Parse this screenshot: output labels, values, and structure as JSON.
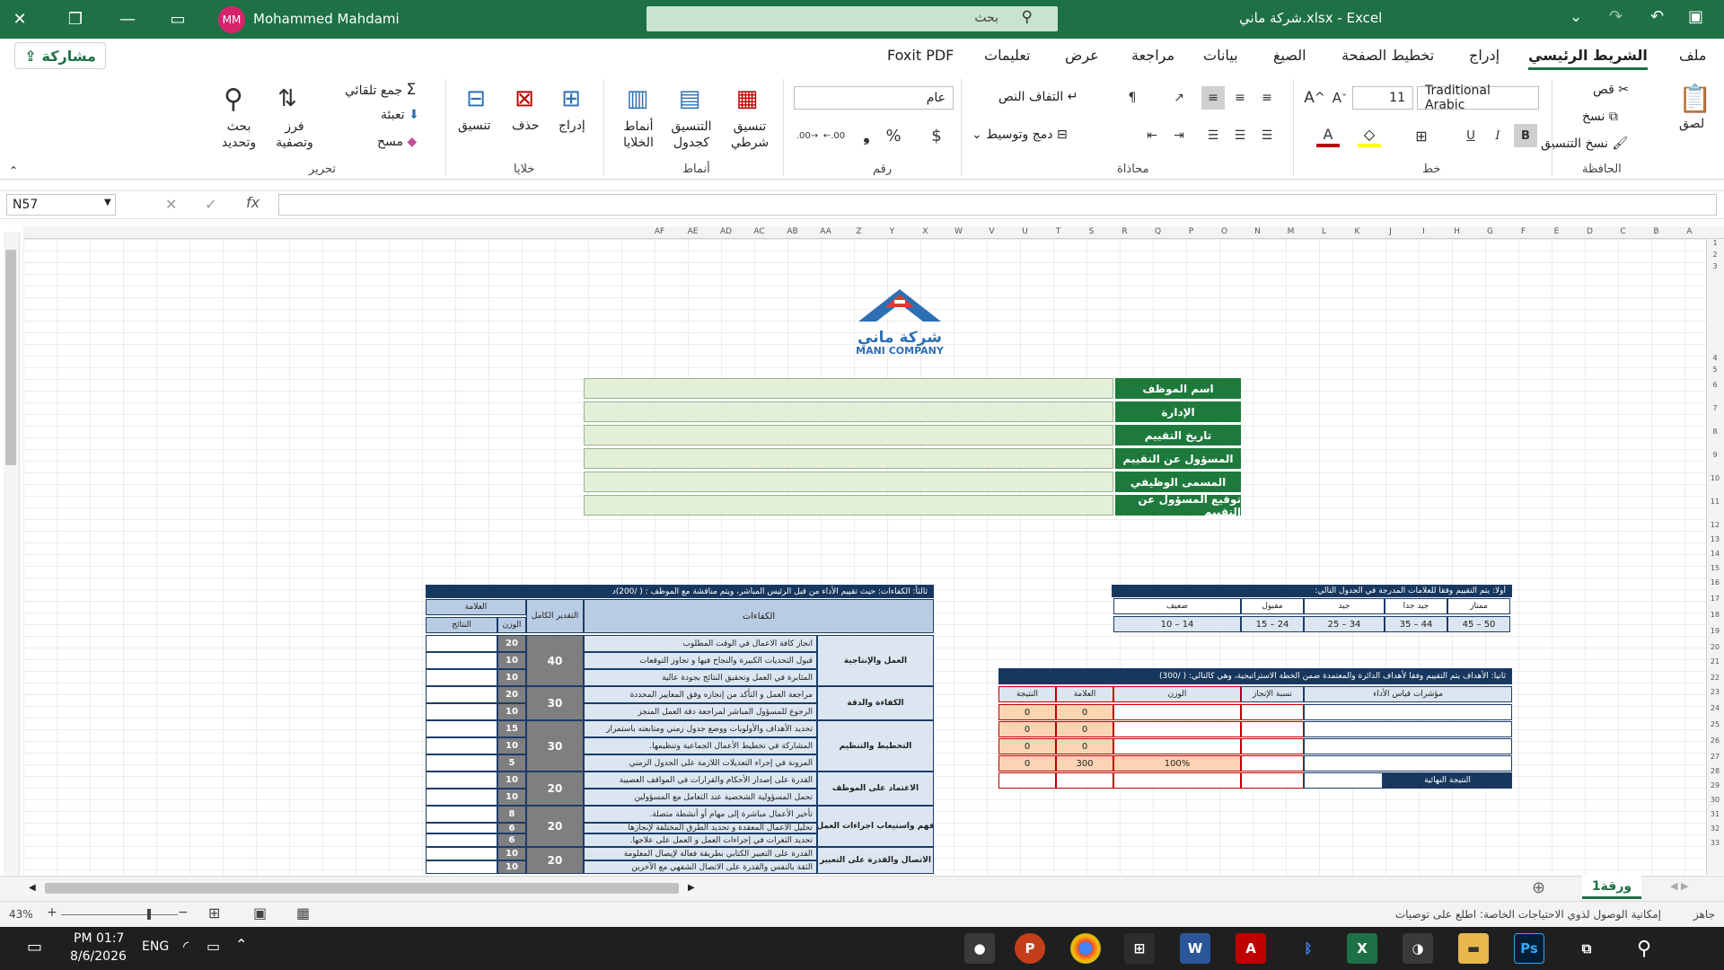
{
  "titlebar": {
    "file_title": "شركة ماني.xlsx  -  Excel",
    "user_name": "Mohammed Mahdami",
    "user_initials": "MM",
    "search_placeholder": "بحث"
  },
  "tabs": [
    "ملف",
    "الشريط الرئيسي",
    "إدراج",
    "تخطيط الصفحة",
    "الصيغ",
    "بيانات",
    "مراجعة",
    "عرض",
    "تعليمات",
    "Foxit PDF"
  ],
  "share_label": "مشاركة",
  "ribbon": {
    "clipboard": {
      "group": "الحافظة",
      "paste": "لصق",
      "cut": "قص",
      "copy": "نسخ",
      "format_painter": "نسخ التنسيق"
    },
    "font": {
      "group": "خط",
      "name": "Traditional Arabic",
      "size": "11"
    },
    "alignment": {
      "group": "محاذاة",
      "wrap": "التفاف النص",
      "merge": "دمج وتوسيط"
    },
    "number": {
      "group": "رقم",
      "format": "عام"
    },
    "styles": {
      "group": "أنماط",
      "conditional": "تنسيق شرطي",
      "as_table": "التنسيق كجدول",
      "cell_styles": "أنماط الخلايا"
    },
    "cells": {
      "group": "خلايا",
      "insert": "إدراج",
      "delete": "حذف",
      "format": "تنسيق"
    },
    "editing": {
      "group": "تحرير",
      "autosum": "جمع تلقائي",
      "fill": "تعبئة",
      "clear": "مسح",
      "sort": "فرز وتصفية",
      "find": "بحث وتحديد"
    }
  },
  "formula_bar": {
    "name_box": "N57",
    "formula": ""
  },
  "columns": [
    "A",
    "B",
    "C",
    "D",
    "E",
    "F",
    "G",
    "H",
    "I",
    "J",
    "K",
    "L",
    "M",
    "N",
    "O",
    "P",
    "Q",
    "R",
    "S",
    "T",
    "U",
    "V",
    "W",
    "X",
    "Y",
    "Z",
    "AA",
    "AB",
    "AC",
    "AD",
    "AE",
    "AF"
  ],
  "rows": [
    "1",
    "2",
    "3",
    "4",
    "5",
    "6",
    "7",
    "8",
    "9",
    "10",
    "11",
    "12",
    "13",
    "14",
    "15",
    "16",
    "17",
    "18",
    "19",
    "20",
    "21",
    "22",
    "23",
    "24",
    "25",
    "26",
    "27",
    "28",
    "29",
    "30",
    "31",
    "32",
    "33"
  ],
  "logo": {
    "text_ar": "شركة ماني",
    "text_en": "MANI COMPANY"
  },
  "info_labels": [
    "اسم الموظف",
    "الإدارة",
    "تاريخ التقييم",
    "المسؤول عن التقييم",
    "المسمى الوظيفي",
    "توقيع المسؤول عن التقييم"
  ],
  "grades": {
    "title": "أولا: يتم التقييم وفقا للعلامات المدرجة في الجدول التالي:",
    "headers": [
      "ممتاز",
      "جيد جدا",
      "جيد",
      "مقبول",
      "ضعيف"
    ],
    "ranges": [
      "50 – 45",
      "44 – 35",
      "34 – 25",
      "24 – 15",
      "14 – 10"
    ]
  },
  "objectives": {
    "title": "ثانيا: الأهداف    يتم التقييم وفقا لأهداف الدائرة والمعتمدة ضمن الخطة الاستراتيجية، وهي كالتالي: (   /300)",
    "headers": [
      "مؤشرات قياس الأداء",
      "نسبة الإنجاز",
      "الوزن",
      "العلامة",
      "النتيجة"
    ],
    "rows": [
      {
        "score": "0",
        "result": "0"
      },
      {
        "score": "0",
        "result": "0"
      },
      {
        "score": "0",
        "result": "0"
      },
      {
        "weight": "100%",
        "score": "300",
        "result": "0"
      }
    ],
    "final_label": "النتيجة النهائية"
  },
  "competencies": {
    "title": "ثالثاً: الكفاءات: حيث تقييم الأداء من قبل الرئيس المباشر، ويتم مناقشة مع الموظف : (     /200)د",
    "headers": {
      "competencies": "الكفاءات",
      "total": "التقدير الكامل",
      "mark": "العلامة",
      "weight": "الوزن",
      "result": "النتائج"
    },
    "groups": [
      {
        "name": "العمل والإنتاجية",
        "total": "40",
        "items": [
          {
            "text": "انجاز كافة الاعمال في الوقت المطلوب",
            "weight": "20"
          },
          {
            "text": "قبول التحديات الكبيرة والنجاح فيها و تجاوز التوقعات",
            "weight": "10"
          },
          {
            "text": "المثابرة في العمل وتحقيق النتائج بجودة عالية",
            "weight": "10"
          }
        ]
      },
      {
        "name": "الكفاءة والدقة",
        "total": "30",
        "items": [
          {
            "text": "مراجعة العمل  و التأكد من إنجازه وفق المعايير المحددة",
            "weight": "20"
          },
          {
            "text": "الرجوع للمسؤول المباشر لمراجعة دقة العمل المنجز",
            "weight": "10"
          }
        ]
      },
      {
        "name": "التخطيط والتنظيم",
        "total": "30",
        "items": [
          {
            "text": "تحديد الأهداف والأولويات ووضع جدول زمني ومتابعته باستمرار",
            "weight": "15"
          },
          {
            "text": "المشاركة في تخطيط الأعمال الجماعية وتنظيمها.",
            "weight": "10"
          },
          {
            "text": "المرونة في إجراء التعديلات اللازمة على الجدول الزمني",
            "weight": "5"
          }
        ]
      },
      {
        "name": "الاعتماد على الموظف",
        "total": "20",
        "items": [
          {
            "text": "القدرة على إصدار الأحكام والقرارات في المواقف العصيبة",
            "weight": "10"
          },
          {
            "text": "تحمل المسؤولية الشخصية عند التعامل مع المسؤولين",
            "weight": "10"
          }
        ]
      },
      {
        "name": "فهم واستيعاب اجراءات العمل",
        "total": "20",
        "items": [
          {
            "text": "تأخير الأعمال مباشرة إلى مهام أو أنشطة متصلة.",
            "weight": "8"
          },
          {
            "text": "تحليل  الأعمال المعقدة و تحديد الطرق المختلفة لإنجازها",
            "weight": "6"
          },
          {
            "text": "تحديد الثغرات في إجراءات العمل و العمل على علاجها.",
            "weight": "6"
          }
        ]
      },
      {
        "name": "الاتصال والقدرة على التعبير",
        "total": "20",
        "items": [
          {
            "text": "القدرة على التعبير الكتابي بطريقة فعالة لإيصال المعلومة",
            "weight": "10"
          },
          {
            "text": "الثقة بالنفس والقدرة على الاتصال الشفهي مع الآخرين",
            "weight": "10"
          }
        ]
      }
    ]
  },
  "sheet_tab": "ورقة1",
  "status": {
    "ready": "جاهز",
    "accessibility": "إمكانية الوصول لذوي الاحتياجات الخاصة: اطلع على توصيات",
    "zoom": "43%"
  },
  "taskbar": {
    "time": "PM 01:7",
    "date": "8/6/2026",
    "lang": "ENG"
  },
  "colors": {
    "excel_green": "#1e7145",
    "navy": "#17375e",
    "accent_red": "#c00000",
    "header_blue": "#b8cce4"
  }
}
